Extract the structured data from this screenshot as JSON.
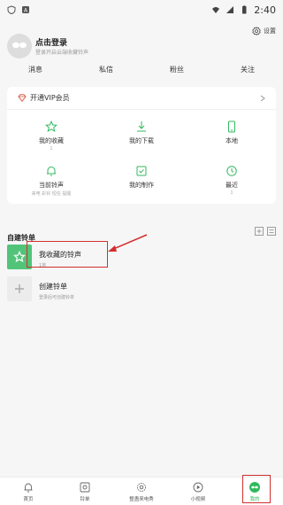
{
  "status_bar": {
    "time": "2:40"
  },
  "profile": {
    "title": "点击登录",
    "subtitle": "登录开启云端收藏铃声",
    "settings_label": "设置"
  },
  "stats": [
    "消息",
    "私信",
    "粉丝",
    "关注"
  ],
  "vip": {
    "label": "开通VIP会员"
  },
  "grid": [
    {
      "label": "我的收藏",
      "count": "1"
    },
    {
      "label": "我的下载",
      "count": ""
    },
    {
      "label": "本地",
      "count": ""
    },
    {
      "label": "当前铃声",
      "sub": "来电 彩铃 短信 提醒"
    },
    {
      "label": "我的制作",
      "count": ""
    },
    {
      "label": "最近",
      "count": "1"
    }
  ],
  "section": {
    "title": "自建铃单"
  },
  "playlists": [
    {
      "name": "我收藏的铃声",
      "sub": "1首"
    },
    {
      "name": "创建铃单",
      "sub": "登录后可创建铃单"
    }
  ],
  "bottom_nav": [
    {
      "label": "首页",
      "icon": "bell-icon"
    },
    {
      "label": "铃单",
      "icon": "photo-icon"
    },
    {
      "label": "整蛊来电秀",
      "icon": "gear-icon"
    },
    {
      "label": "小视频",
      "icon": "play-icon"
    },
    {
      "label": "我的",
      "icon": "avatar-icon"
    }
  ],
  "colors": {
    "accent": "#2fb85c",
    "highlight": "#d32f2f",
    "vip": "#e0604f"
  }
}
